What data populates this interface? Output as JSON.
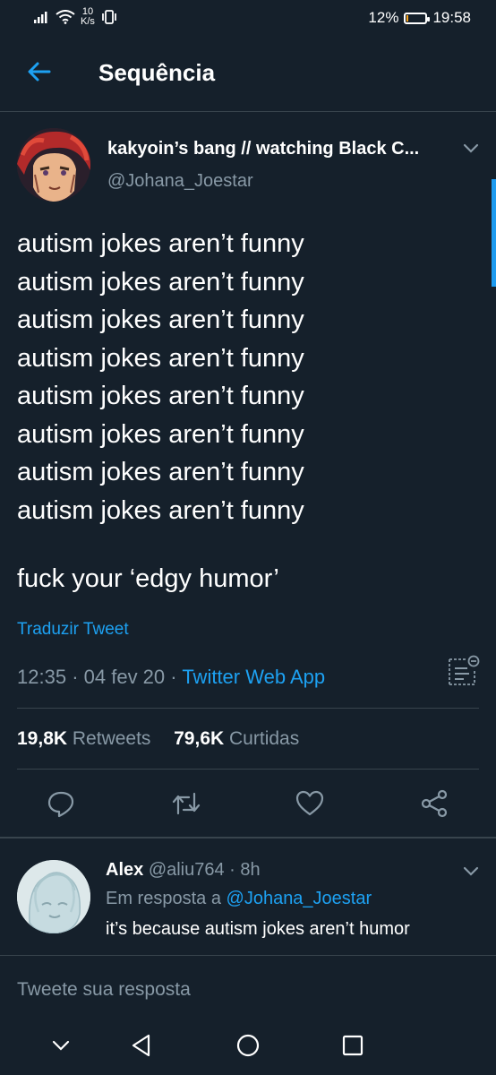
{
  "status_bar": {
    "speed_value": "10",
    "speed_unit": "K/s",
    "battery_percent": "12%",
    "battery_level": 0.12,
    "time": "19:58"
  },
  "header": {
    "title": "Sequência",
    "back_icon": "arrow-left-icon"
  },
  "tweet": {
    "author_name": "kakyoin’s bang // watching Black C...",
    "author_handle": "@Johana_Joestar",
    "body_lines": [
      "autism jokes aren’t funny",
      "autism jokes aren’t funny",
      "autism jokes aren’t funny",
      "autism jokes aren’t funny",
      "autism jokes aren’t funny",
      "autism jokes aren’t funny",
      "autism jokes aren’t funny",
      "autism jokes aren’t funny"
    ],
    "body_final": "fuck your ‘edgy humor’",
    "translate_label": "Traduzir Tweet",
    "time": "12:35",
    "date": "04 fev 20",
    "source": "Twitter Web App",
    "retweets_count": "19,8K",
    "retweets_label": "Retweets",
    "likes_count": "79,6K",
    "likes_label": "Curtidas",
    "actions": [
      "reply-icon",
      "retweet-icon",
      "like-icon",
      "share-icon"
    ]
  },
  "reply": {
    "name": "Alex",
    "handle": "@aliu764",
    "age": "8h",
    "reply_prefix": "Em resposta a",
    "reply_mention": "@Johana_Joestar",
    "text": "it’s because autism jokes aren’t humor"
  },
  "compose": {
    "placeholder": "Tweete sua resposta"
  },
  "colors": {
    "background": "#15202b",
    "accent": "#1da1f2",
    "muted": "#8899a6",
    "divider": "#38444d"
  }
}
